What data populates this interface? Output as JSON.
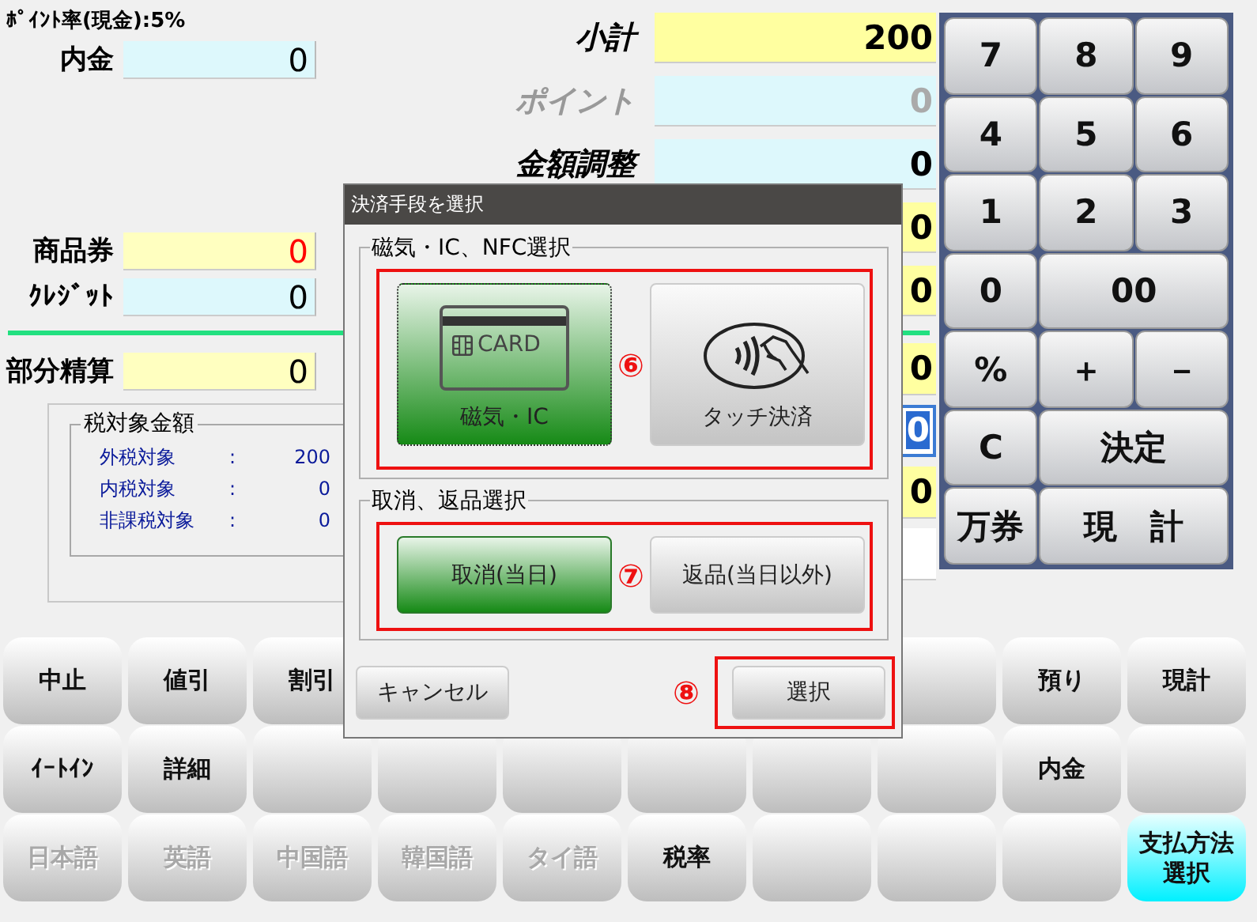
{
  "left_panel": {
    "point_rate": "ﾎﾟｲﾝﾄ率(現金):5%",
    "upper_fields": [
      {
        "label": "内金",
        "value": "0",
        "color": "#ddf8fc",
        "alert": false
      },
      {
        "label": "商品券",
        "value": "0",
        "color": "#ffffc0",
        "alert": true
      },
      {
        "label": "ｸﾚｼﾞｯﾄ",
        "value": "0",
        "color": "#ddf8fc",
        "alert": false
      }
    ],
    "lower_fields": [
      {
        "label": "部分精算",
        "value": "0",
        "color": "#ffffc0",
        "alert": false
      }
    ],
    "tax_box": {
      "title": "税対象金額",
      "rows": [
        {
          "label": "外税対象",
          "separator": ":",
          "value": "200"
        },
        {
          "label": "内税対象",
          "separator": ":",
          "value": "0"
        },
        {
          "label": "非課税対象",
          "separator": ":",
          "value": "0"
        }
      ]
    }
  },
  "totals": [
    {
      "label": "小計",
      "value": "200",
      "color": "#ffffa0",
      "disabled": false,
      "focused": false
    },
    {
      "label": "ポイント",
      "value": "0",
      "color": "#ddf8fc",
      "disabled": true,
      "focused": false
    },
    {
      "label": "金額調整",
      "value": "0",
      "color": "#ddf8fc",
      "disabled": false,
      "focused": false
    },
    {
      "value": "0",
      "color": "#ffffa0",
      "disabled": false,
      "focused": false
    },
    {
      "value": "0",
      "color": "#ffffa0",
      "disabled": false,
      "focused": false
    }
  ],
  "settlement": [
    {
      "value": "0",
      "color": "#ffffa0",
      "focused": false
    },
    {
      "value": "0",
      "color": "#ffffff",
      "focused": true
    },
    {
      "value": "0",
      "color": "#ffffa0",
      "focused": false
    },
    {
      "color": "#ffffff",
      "focused": false
    }
  ],
  "keypad": [
    {
      "label": "7",
      "wide": false
    },
    {
      "label": "8",
      "wide": false
    },
    {
      "label": "9",
      "wide": false
    },
    {
      "label": "4",
      "wide": false
    },
    {
      "label": "5",
      "wide": false
    },
    {
      "label": "6",
      "wide": false
    },
    {
      "label": "1",
      "wide": false
    },
    {
      "label": "2",
      "wide": false
    },
    {
      "label": "3",
      "wide": false
    },
    {
      "label": "0",
      "wide": false
    },
    {
      "label": "00",
      "wide": true
    },
    {
      "label": "%",
      "wide": false
    },
    {
      "label": "＋",
      "wide": false
    },
    {
      "label": "－",
      "wide": false
    },
    {
      "label": "C",
      "wide": false
    },
    {
      "label": "決定",
      "wide": true
    },
    {
      "label": "万券",
      "wide": false
    },
    {
      "label": "現　計",
      "wide": true
    }
  ],
  "function_keys": [
    {
      "kind": "key",
      "label": "中止",
      "disabled": false,
      "accent": false
    },
    {
      "kind": "key",
      "label": "値引",
      "disabled": false,
      "accent": false
    },
    {
      "kind": "key",
      "label": "割引",
      "disabled": false,
      "accent": false
    },
    {
      "kind": "covered"
    },
    {
      "kind": "covered"
    },
    {
      "kind": "covered"
    },
    {
      "kind": "covered"
    },
    {
      "kind": "blank"
    },
    {
      "kind": "key",
      "label": "預り",
      "disabled": false,
      "accent": false
    },
    {
      "kind": "key",
      "label": "現計",
      "disabled": false,
      "accent": false
    },
    {
      "kind": "key",
      "label": "ｲｰﾄｲﾝ",
      "disabled": false,
      "accent": false
    },
    {
      "kind": "key",
      "label": "詳細",
      "disabled": false,
      "accent": false
    },
    {
      "kind": "blank"
    },
    {
      "kind": "blank"
    },
    {
      "kind": "blank"
    },
    {
      "kind": "blank"
    },
    {
      "kind": "blank"
    },
    {
      "kind": "blank"
    },
    {
      "kind": "key",
      "label": "内金",
      "disabled": false,
      "accent": false
    },
    {
      "kind": "blank"
    },
    {
      "kind": "key",
      "label": "日本語",
      "disabled": true,
      "accent": false
    },
    {
      "kind": "key",
      "label": "英語",
      "disabled": true,
      "accent": false
    },
    {
      "kind": "key",
      "label": "中国語",
      "disabled": true,
      "accent": false
    },
    {
      "kind": "key",
      "label": "韓国語",
      "disabled": true,
      "accent": false
    },
    {
      "kind": "key",
      "label": "タイ語",
      "disabled": true,
      "accent": false
    },
    {
      "kind": "key",
      "label": "税率",
      "disabled": false,
      "accent": false
    },
    {
      "kind": "blank"
    },
    {
      "kind": "blank"
    },
    {
      "kind": "blank"
    },
    {
      "kind": "key",
      "label": "支払方法選択",
      "disabled": false,
      "accent": true
    }
  ],
  "dialog": {
    "title": "決済手段を選択",
    "groups": [
      {
        "title": "磁気・IC、NFC選択",
        "marker": "⑥",
        "options": [
          {
            "kind": "card",
            "label": "磁気・IC",
            "card_text": "CARD",
            "selected": true
          },
          {
            "kind": "contactless",
            "label": "タッチ決済",
            "selected": false
          }
        ]
      },
      {
        "title": "取消、返品選択",
        "marker": "⑦",
        "options": [
          {
            "kind": "text",
            "label": "取消(当日)",
            "selected": true
          },
          {
            "kind": "text",
            "label": "返品(当日以外)",
            "selected": false
          }
        ]
      }
    ],
    "cancel": "キャンセル",
    "confirm_marker": "⑧",
    "confirm": "選択"
  }
}
